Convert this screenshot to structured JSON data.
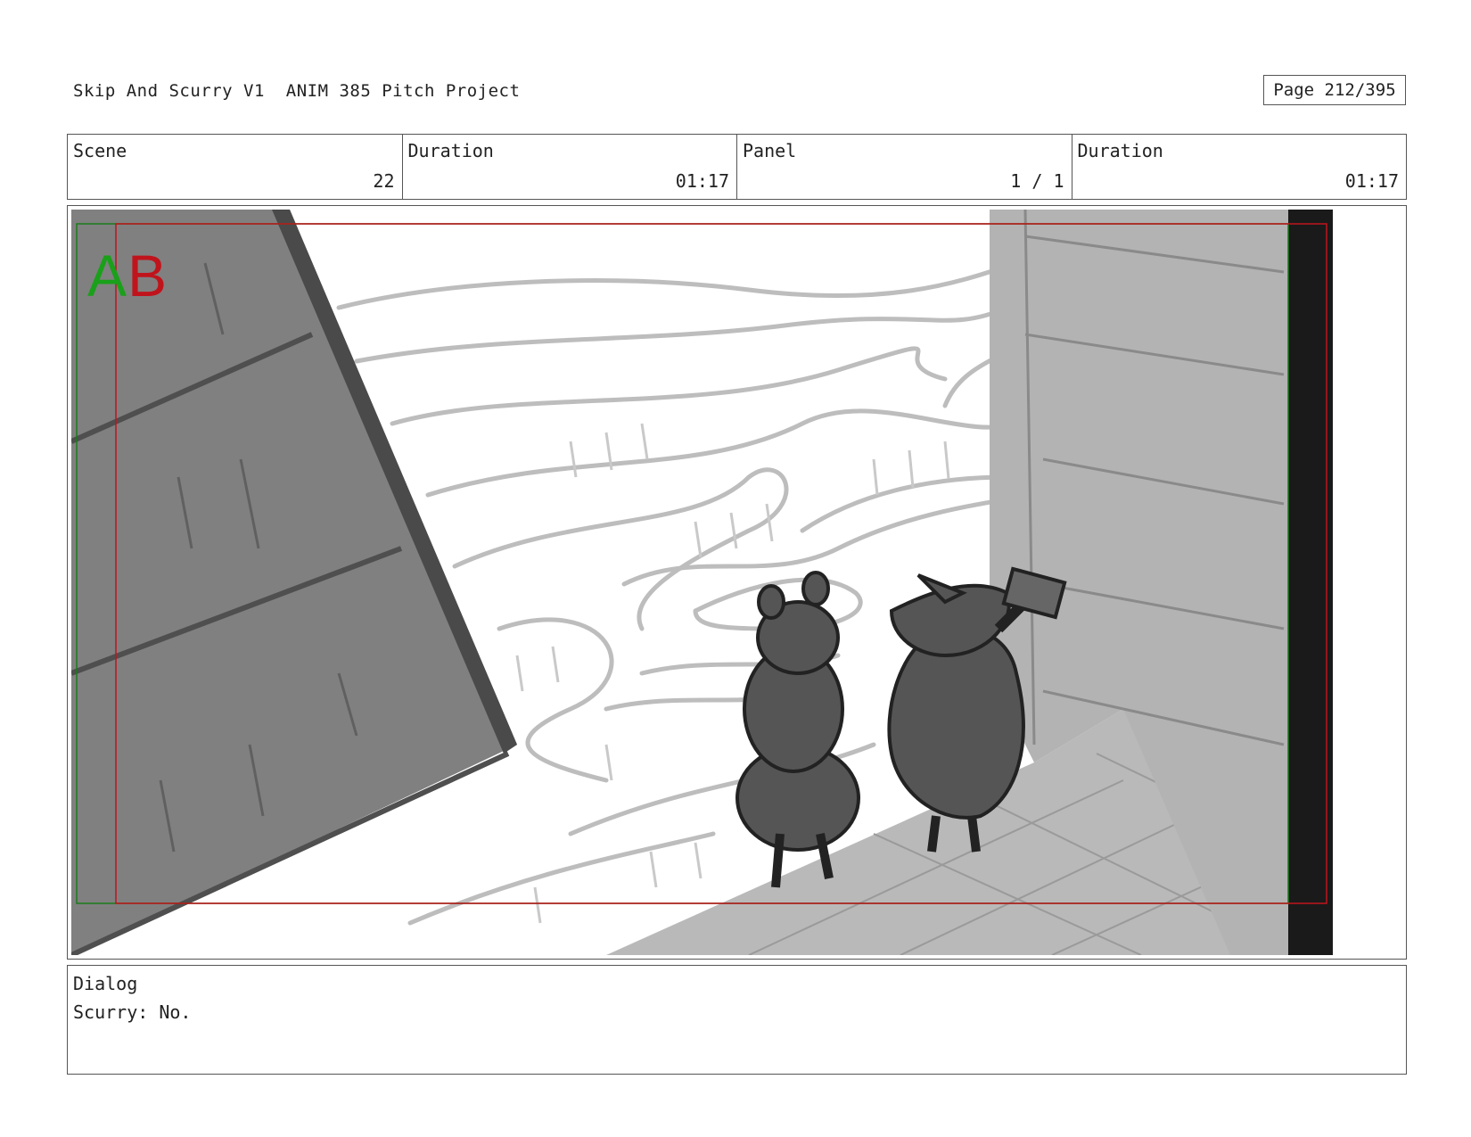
{
  "header": {
    "title": "Skip And Scurry V1  ANIM 385 Pitch Project",
    "page": "Page 212/395"
  },
  "info": {
    "scene_label": "Scene",
    "scene_value": "22",
    "duration_label": "Duration",
    "duration_value": "01:17",
    "panel_label": "Panel",
    "panel_value": "1 / 1",
    "panel_duration_label": "Duration",
    "panel_duration_value": "01:17"
  },
  "frame": {
    "marker_a": "A",
    "marker_b": "B",
    "marker_a_color": "#1aa01a",
    "marker_b_color": "#c0141c",
    "safe_frame_color": "#c0141c",
    "action_frame_color": "#1a7a1a"
  },
  "dialog": {
    "label": "Dialog",
    "text": "Scurry: No."
  }
}
